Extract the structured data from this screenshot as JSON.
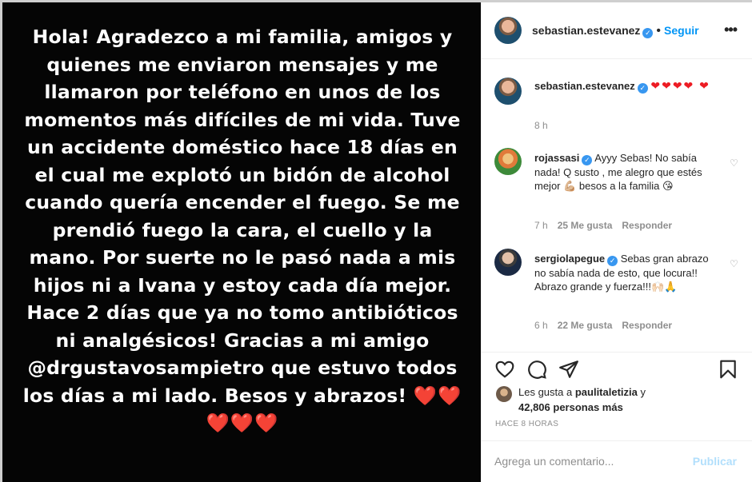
{
  "story": {
    "text": "Hola! Agradezco a mi familia, amigos y quienes me enviaron mensajes y me llamaron por teléfono en unos de los momentos más difíciles de mi vida. Tuve un accidente doméstico hace 18 días en el cual me explotó un bidón de alcohol cuando quería encender el fuego. Se me prendió fuego la cara, el cuello y la mano. Por suerte no le pasó nada a mis hijos ni a Ivana y estoy cada día mejor. Hace 2 días que ya no tomo antibióticos ni analgésicos! Gracias a mi amigo @drgustavosampietro que estuvo todos los días a mi lado. Besos y abrazos!",
    "hearts": "❤️❤️❤️❤️❤️"
  },
  "header": {
    "username": "sebastian.estevanez",
    "follow_label": "Seguir",
    "more_icon": "more-horizontal-icon"
  },
  "caption": {
    "username": "sebastian.estevanez",
    "hearts": "❤❤❤❤ ❤",
    "time": "8 h"
  },
  "comments": [
    {
      "username": "rojassasi",
      "text": "Ayyy Sebas! No sabía nada! Q susto , me alegro que estés mejor 💪🏼 besos a la familia 😘",
      "time": "7 h",
      "likes": "25 Me gusta",
      "reply": "Responder"
    },
    {
      "username": "sergiolapegue",
      "text": "Sebas gran abrazo no sabía nada de esto, que locura!! Abrazo grande y fuerza!!!🙌🏻🙏",
      "time": "6 h",
      "likes": "22 Me gusta",
      "reply": "Responder"
    }
  ],
  "likes": {
    "prefix": "Les gusta a",
    "user": "paulitaletizia",
    "connector": "y",
    "count": "42,806 personas más"
  },
  "time_ago": "HACE 8 HORAS",
  "add_comment": {
    "placeholder": "Agrega un comentario...",
    "post_label": "Publicar"
  },
  "icons": [
    "heart-icon",
    "comment-icon",
    "share-icon",
    "bookmark-icon"
  ],
  "colors": {
    "link": "#0095f6",
    "verified": "#3897f0",
    "heart": "#ed1c24",
    "muted": "#8e8e8e"
  }
}
